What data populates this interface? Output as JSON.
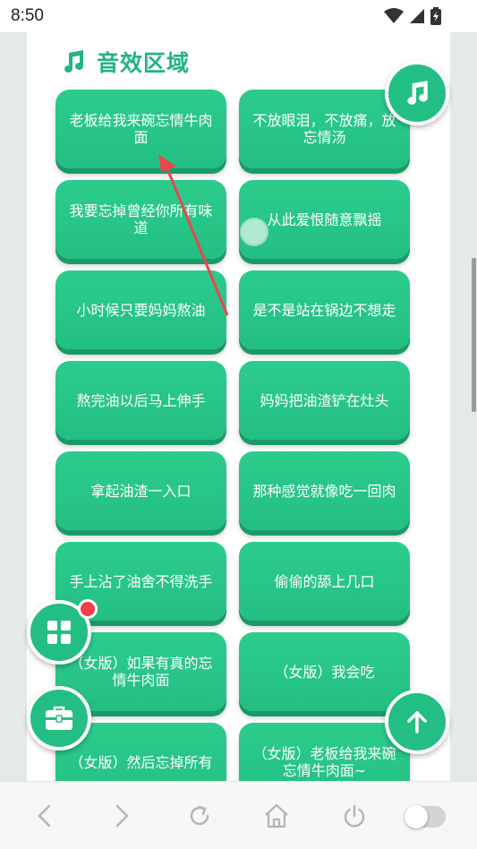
{
  "status_bar": {
    "time": "8:50"
  },
  "section": {
    "title": "音效区域",
    "icon": "music-note-icon"
  },
  "sound_buttons": [
    {
      "label": "老板给我来碗忘情牛肉面"
    },
    {
      "label": "不放眼泪，不放痛，放忘情汤"
    },
    {
      "label": "我要忘掉曾经你所有味道"
    },
    {
      "label": "从此爱恨随意飘摇"
    },
    {
      "label": "小时候只要妈妈熬油"
    },
    {
      "label": "是不是站在锅边不想走"
    },
    {
      "label": "熬完油以后马上伸手"
    },
    {
      "label": "妈妈把油渣铲在灶头"
    },
    {
      "label": "拿起油渣一入口"
    },
    {
      "label": "那种感觉就像吃一回肉"
    },
    {
      "label": "手上沾了油舍不得洗手"
    },
    {
      "label": "偷偷的舔上几口"
    },
    {
      "label": "（女版）如果有真的忘情牛肉面"
    },
    {
      "label": "（女版）我会吃"
    },
    {
      "label": "（女版）然后忘掉所有"
    },
    {
      "label": "（女版）老板给我来碗忘情牛肉面~"
    }
  ],
  "floating_buttons": {
    "music": {
      "icon": "music-note-icon"
    },
    "apps": {
      "icon": "grid-icon",
      "badge": "red-dot"
    },
    "toolbox": {
      "icon": "toolbox-icon"
    },
    "scroll_top": {
      "icon": "arrow-up-icon"
    }
  },
  "nav_bar": {
    "items": [
      "back-icon",
      "forward-icon",
      "refresh-icon",
      "home-icon",
      "power-icon",
      "toggle"
    ]
  },
  "colors": {
    "accent": "#23bf82",
    "accent_dark": "#1a9a68",
    "badge": "#f23b4b",
    "annotation_arrow": "#e8474c"
  }
}
